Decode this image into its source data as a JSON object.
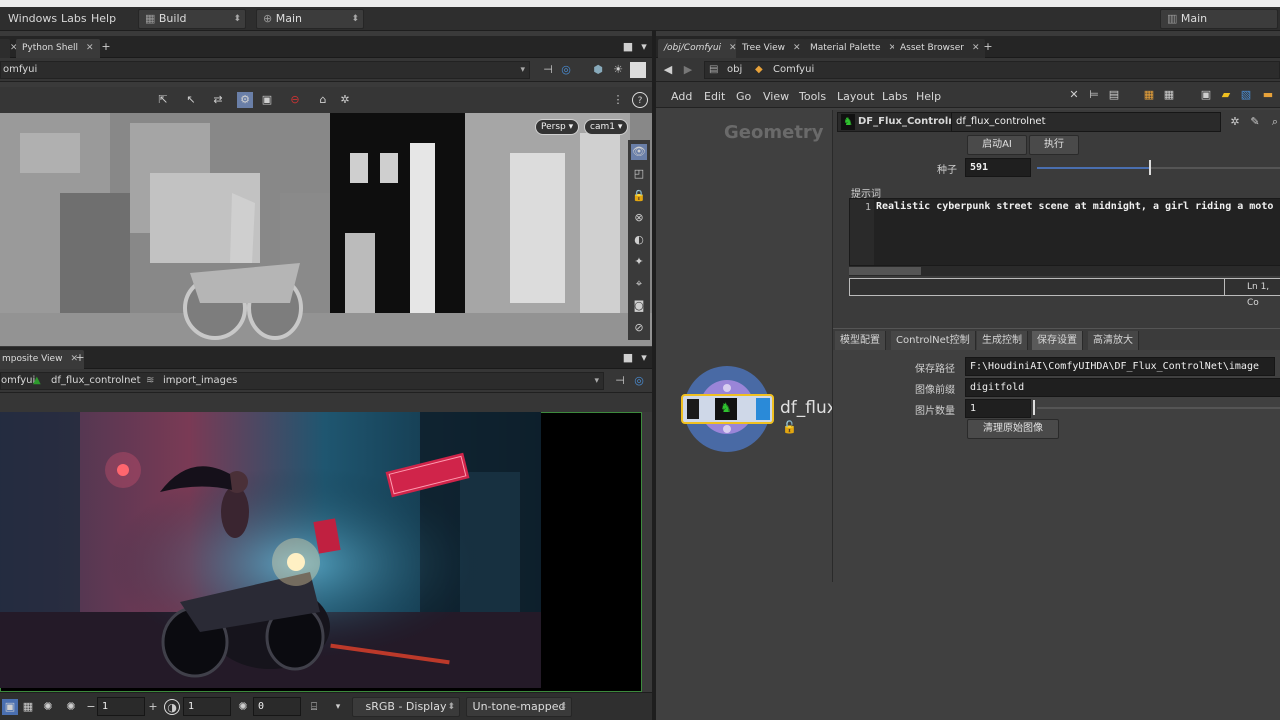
{
  "menubar": {
    "items": [
      "Windows",
      "Labs",
      "Help"
    ],
    "desktop": "Build",
    "takes": "Main",
    "right_main": "Main"
  },
  "left_top": {
    "tabs": [
      "Python Shell"
    ],
    "path": "omfyui",
    "persp": "Persp",
    "cam": "cam1"
  },
  "left_bottom": {
    "tabs": [
      "mposite View"
    ],
    "path_items": [
      "omfyui",
      "df_flux_controlnet",
      "import_images"
    ]
  },
  "bottombar": {
    "frame_a": "1",
    "frame_b": "1",
    "frame_c": "0",
    "colorspace": "sRGB - Display",
    "tonemap": "Un-tone-mapped"
  },
  "right": {
    "tabs": [
      "/obj/Comfyui",
      "Tree View",
      "Material Palette",
      "Asset Browser"
    ],
    "path_items": [
      "obj",
      "Comfyui"
    ],
    "menu": [
      "Add",
      "Edit",
      "Go",
      "View",
      "Tools",
      "Layout",
      "Labs",
      "Help"
    ],
    "network_label": "Geometry",
    "node_label": "df_flux"
  },
  "params": {
    "node_type": "DF_Flux_Controlnet",
    "node_name": "df_flux_controlnet",
    "btn_start": "启动AI",
    "btn_exec": "执行",
    "seed_label": "种子",
    "seed_value": "591",
    "seed_fraction": 0.46,
    "prompt_label": "提示词",
    "prompt_line": "1",
    "prompt_text": "Realistic cyberpunk street scene at midnight, a girl riding a moto",
    "status": "Ln 1, Co",
    "tabs": [
      "模型配置",
      "ControlNet控制",
      "生成控制",
      "保存设置",
      "高清放大"
    ],
    "active_tab": 3,
    "save_path_label": "保存路径",
    "save_path": "F:\\HoudiniAI\\ComfyUIHDA\\DF_Flux_ControlNet\\image",
    "prefix_label": "图像前缀",
    "prefix": "digitfold",
    "count_label": "图片数量",
    "count": "1",
    "clear_btn": "清理原始图像"
  },
  "colors": {
    "accent_blue": "#4a6fb0",
    "node_yellow": "#f0c020",
    "viewer_border": "#3d8a3d"
  }
}
